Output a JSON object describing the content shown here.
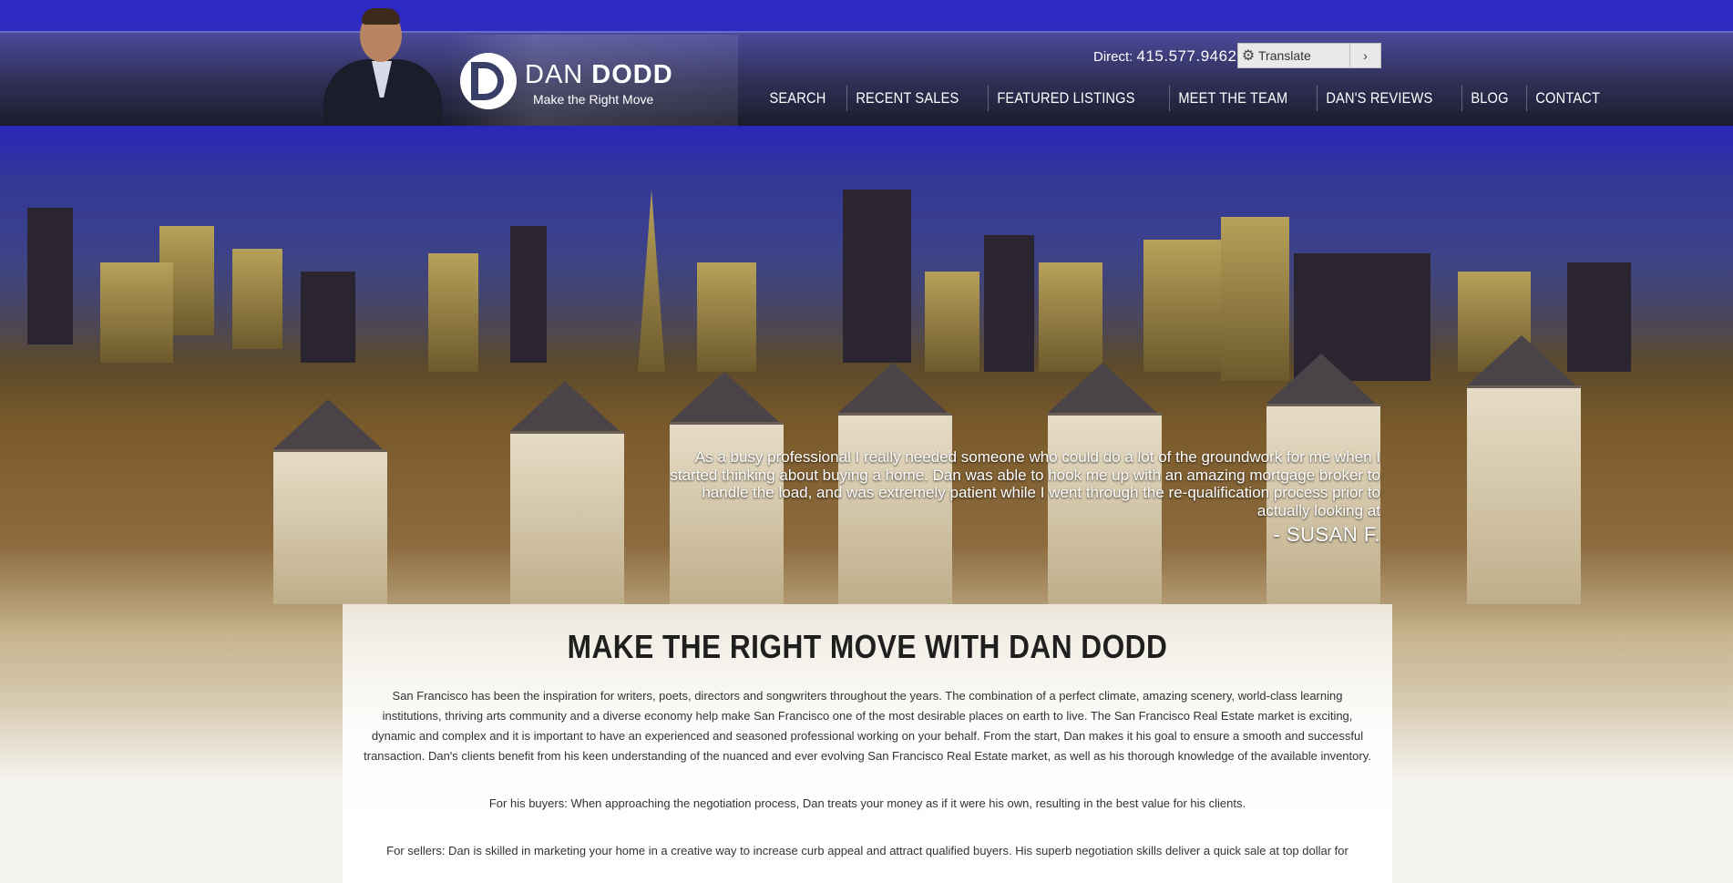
{
  "header": {
    "logo_name_light": "DAN",
    "logo_name_bold": "DODD",
    "logo_tagline": "Make the Right Move",
    "direct_label": "Direct:",
    "direct_phone": "415.577.9462",
    "translate_label": "Translate",
    "translate_arrow": "›"
  },
  "nav": {
    "items": [
      {
        "label": "SEARCH"
      },
      {
        "label": "RECENT SALES"
      },
      {
        "label": "FEATURED LISTINGS"
      },
      {
        "label": "MEET THE TEAM"
      },
      {
        "label": "DAN'S REVIEWS"
      },
      {
        "label": "BLOG"
      },
      {
        "label": "CONTACT"
      }
    ]
  },
  "testimonial": {
    "text": "As a busy professional I really needed someone who could do a lot of the groundwork for me when I started thinking about buying a home. Dan was able to hook me up with an amazing mortgage broker to handle the load, and was extremely patient while I went through the re-qualification process prior to actually looking at",
    "author": "- SUSAN F."
  },
  "main": {
    "title": "MAKE THE RIGHT MOVE WITH DAN DODD",
    "paragraphs": [
      "San Francisco has been the inspiration for writers, poets, directors and songwriters throughout the years. The combination of a perfect climate, amazing scenery, world-class learning institutions, thriving arts community and a diverse economy help make San Francisco one of the most desirable places on earth to live. The San Francisco Real Estate market is exciting, dynamic and complex and it is important to have an experienced and seasoned professional working on your behalf. From the start, Dan makes it his goal to ensure a smooth and successful transaction. Dan's clients benefit from his keen understanding of the nuanced and ever evolving San Francisco Real Estate market, as well as his thorough knowledge of the available inventory.",
      "For his buyers: When approaching the negotiation process, Dan treats your money as if it were his own, resulting in the best value for his clients.",
      "For sellers: Dan is skilled in marketing your home in a creative way to increase curb appeal and attract qualified buyers. His superb negotiation skills deliver a quick sale at top dollar for"
    ]
  },
  "colors": {
    "top_band": "#2c2ac4",
    "header_dark": "#1c1c2c",
    "nav_text": "#ffffff"
  }
}
